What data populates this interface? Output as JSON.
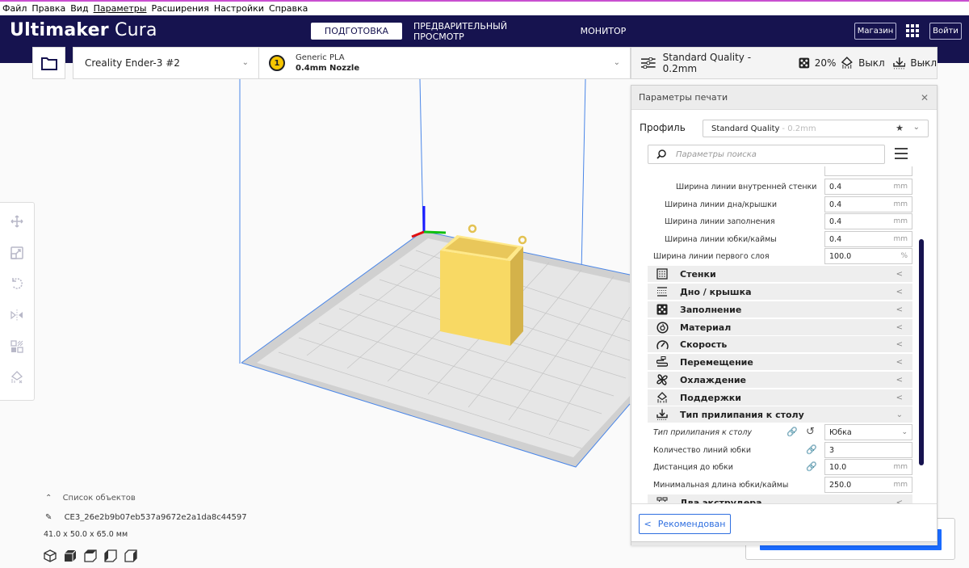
{
  "menubar": {
    "items": [
      "Файл",
      "Правка",
      "Вид",
      "Параметры",
      "Расширения",
      "Настройки",
      "Справка"
    ]
  },
  "header": {
    "logo_bold": "Ultimaker",
    "logo_light": "Cura",
    "stages": [
      {
        "label": "ПОДГОТОВКА",
        "active": true
      },
      {
        "label": "ПРЕДВАРИТЕЛЬНЫЙ ПРОСМОТР",
        "active": false
      },
      {
        "label": "МОНИТОР",
        "active": false
      }
    ],
    "marketplace_label": "Магазин",
    "apps_icon": "grid-apps-icon",
    "signin_label": "Войти"
  },
  "toolbar": {
    "open_icon": "folder-icon",
    "printer": "Creality Ender-3 #2",
    "material": {
      "extruder_number": "1",
      "name": "Generic PLA",
      "nozzle": "0.4mm Nozzle"
    },
    "quality": {
      "profile": "Standard Quality - 0.2mm",
      "infill": "20%",
      "support": "Выкл",
      "adhesion": "Выкл"
    }
  },
  "left_tools": [
    "move-icon",
    "scale-icon",
    "rotate-icon",
    "mirror-icon",
    "per-model-settings-icon",
    "support-blocker-icon"
  ],
  "object_list": {
    "toggle_label": "Список объектов",
    "object_name": "CE3_26e2b9b07eb537a9672e2a1da8c44597",
    "dimensions": "41.0 x 50.0 x 65.0 мм",
    "view_icons": [
      "3d-view-icon",
      "front-view-icon",
      "top-view-icon",
      "left-view-icon",
      "right-view-icon"
    ]
  },
  "print_settings": {
    "title": "Параметры печати",
    "profile_label": "Профиль",
    "profile_value": "Standard Quality",
    "profile_suffix": "- 0.2mm",
    "search_placeholder": "Параметры поиска",
    "rows_top": [
      {
        "label": "Ширина линии внутренней стенки",
        "value": "0.4",
        "unit": "mm",
        "indent": 2
      },
      {
        "label": "Ширина линии дна/крышки",
        "value": "0.4",
        "unit": "mm",
        "indent": 1
      },
      {
        "label": "Ширина линии заполнения",
        "value": "0.4",
        "unit": "mm",
        "indent": 1
      },
      {
        "label": "Ширина линии юбки/каймы",
        "value": "0.4",
        "unit": "mm",
        "indent": 1
      },
      {
        "label": "Ширина линии первого слоя",
        "value": "100.0",
        "unit": "%",
        "indent": 0
      }
    ],
    "categories": [
      {
        "label": "Стенки",
        "icon": "walls-icon",
        "expanded": false
      },
      {
        "label": "Дно / крышка",
        "icon": "top-bottom-icon",
        "expanded": false
      },
      {
        "label": "Заполнение",
        "icon": "infill-icon",
        "expanded": false
      },
      {
        "label": "Материал",
        "icon": "material-spool-icon",
        "expanded": false
      },
      {
        "label": "Скорость",
        "icon": "speed-gauge-icon",
        "expanded": false
      },
      {
        "label": "Перемещение",
        "icon": "travel-icon",
        "expanded": false
      },
      {
        "label": "Охлаждение",
        "icon": "fan-icon",
        "expanded": false
      },
      {
        "label": "Поддержки",
        "icon": "support-icon",
        "expanded": false
      },
      {
        "label": "Тип прилипания к столу",
        "icon": "adhesion-icon",
        "expanded": true
      }
    ],
    "adhesion_rows": [
      {
        "label": "Тип прилипания к столу",
        "value": "Юбка",
        "unit": "",
        "type": "select",
        "linked": true,
        "resettable": true
      },
      {
        "label": "Количество линий юбки",
        "value": "3",
        "unit": "",
        "type": "input",
        "linked": true,
        "resettable": false
      },
      {
        "label": "Дистанция до юбки",
        "value": "10.0",
        "unit": "mm",
        "type": "input",
        "linked": true,
        "resettable": false
      },
      {
        "label": "Минимальная длина юбки/каймы",
        "value": "250.0",
        "unit": "mm",
        "type": "input",
        "linked": false,
        "resettable": false
      }
    ],
    "dual_category": {
      "label": "Два экструдера",
      "icon": "dual-extruder-icon"
    },
    "recommended_label": "Рекомендован"
  }
}
